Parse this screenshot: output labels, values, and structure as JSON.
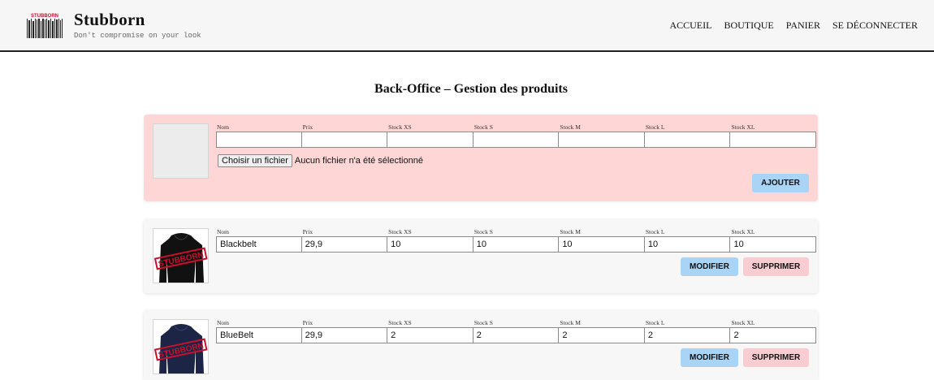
{
  "header": {
    "logo_text": "STUBBORN",
    "brand": "Stubborn",
    "tagline": "Don't compromise on your look",
    "nav": [
      "ACCUEIL",
      "BOUTIQUE",
      "PANIER",
      "SE DÉCONNECTER"
    ]
  },
  "page_title": "Back-Office – Gestion des produits",
  "labels": [
    "Nom",
    "Prix",
    "Stock XS",
    "Stock S",
    "Stock M",
    "Stock L",
    "Stock XL"
  ],
  "new_product": {
    "file_button": "Choisir un fichier",
    "file_status": "Aucun fichier n'a été sélectionné",
    "add_label": "AJOUTER"
  },
  "products": [
    {
      "values": [
        "Blackbelt",
        "29,9",
        "10",
        "10",
        "10",
        "10",
        "10"
      ],
      "stamp_text": "STUBBORN",
      "hoodie_color": "#111111",
      "edit_label": "MODIFIER",
      "delete_label": "SUPPRIMER"
    },
    {
      "values": [
        "BlueBelt",
        "29,9",
        "2",
        "2",
        "2",
        "2",
        "2"
      ],
      "stamp_text": "STUBBORN",
      "hoodie_color": "#1c2546",
      "edit_label": "MODIFIER",
      "delete_label": "SUPPRIMER"
    }
  ],
  "colors": {
    "new_card_bg": "#ffd6d6",
    "product_card_bg": "#f7f7f7",
    "edit_button": "#a9d4f5",
    "delete_button": "#f7cdd1",
    "stamp_red": "#c8102e"
  }
}
